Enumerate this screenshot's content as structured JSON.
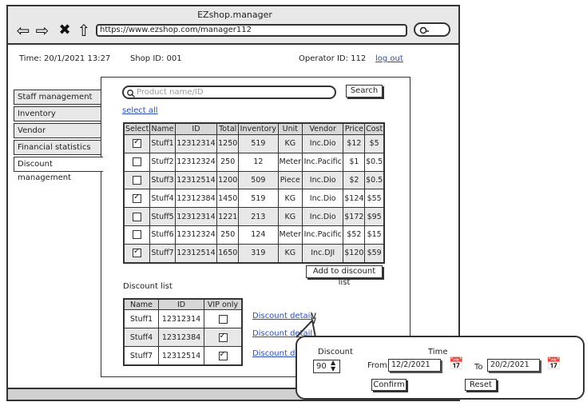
{
  "app": {
    "title": "EZshop.manager"
  },
  "browser": {
    "url": "https://www.ezshop.com/manager112"
  },
  "info": {
    "time": "Time: 20/1/2021 13:27",
    "shop_id": "Shop ID: 001",
    "operator_id": "Operator ID: 112",
    "logout": "log out"
  },
  "sidebar": {
    "items": [
      {
        "label": "Staff management"
      },
      {
        "label": "Inventory management"
      },
      {
        "label": "Vendor communication"
      },
      {
        "label": "Financial statistics"
      },
      {
        "label": "Discount management"
      }
    ]
  },
  "search": {
    "placeholder": "Product name/ID",
    "button": "Search",
    "select_all": "select all"
  },
  "products": {
    "headers": [
      "Select",
      "Name",
      "ID",
      "Total",
      "Inventory",
      "Unit",
      "Vendor",
      "Price",
      "Cost"
    ],
    "rows": [
      {
        "checked": true,
        "name": "Stuff1",
        "id": "12312314",
        "total": "1250",
        "inventory": "519",
        "unit": "KG",
        "vendor": "Inc.Dio",
        "price": "$12",
        "cost": "$5"
      },
      {
        "checked": false,
        "name": "Stuff2",
        "id": "12312324",
        "total": "250",
        "inventory": "12",
        "unit": "Meter",
        "vendor": "Inc.Pacific",
        "price": "$1",
        "cost": "$0.5"
      },
      {
        "checked": false,
        "name": "Stuff3",
        "id": "12312514",
        "total": "1200",
        "inventory": "509",
        "unit": "Piece",
        "vendor": "Inc.Dio",
        "price": "$2",
        "cost": "$0.5"
      },
      {
        "checked": true,
        "name": "Stuff4",
        "id": "12312384",
        "total": "1450",
        "inventory": "519",
        "unit": "KG",
        "vendor": "Inc.Dio",
        "price": "$124",
        "cost": "$55"
      },
      {
        "checked": false,
        "name": "Stuff5",
        "id": "12312314",
        "total": "1221",
        "inventory": "213",
        "unit": "KG",
        "vendor": "Inc.Dio",
        "price": "$172",
        "cost": "$95"
      },
      {
        "checked": false,
        "name": "Stuff6",
        "id": "12312324",
        "total": "250",
        "inventory": "124",
        "unit": "Meter",
        "vendor": "Inc.Pacific",
        "price": "$52",
        "cost": "$15"
      },
      {
        "checked": true,
        "name": "Stuff7",
        "id": "12312514",
        "total": "1650",
        "inventory": "319",
        "unit": "KG",
        "vendor": "Inc.DJI",
        "price": "$120",
        "cost": "$59"
      }
    ],
    "add_button": "Add to discount list"
  },
  "discount_list": {
    "title": "Discount list",
    "headers": [
      "Name",
      "ID",
      "VIP only"
    ],
    "rows": [
      {
        "name": "Stuff1",
        "id": "12312314",
        "vip": false,
        "link": "Discount detail"
      },
      {
        "name": "Stuff4",
        "id": "12312384",
        "vip": true,
        "link": "Discount detail"
      },
      {
        "name": "Stuff7",
        "id": "12312514",
        "vip": true,
        "link": "Discount detail"
      }
    ]
  },
  "popup": {
    "discount_label": "Discount",
    "discount_value": "90",
    "time_label": "Time",
    "from_label": "From",
    "from_date": "12/2/2021",
    "to_label": "To",
    "to_date": "20/2/2021",
    "confirm": "Confirm",
    "reset": "Reset"
  }
}
